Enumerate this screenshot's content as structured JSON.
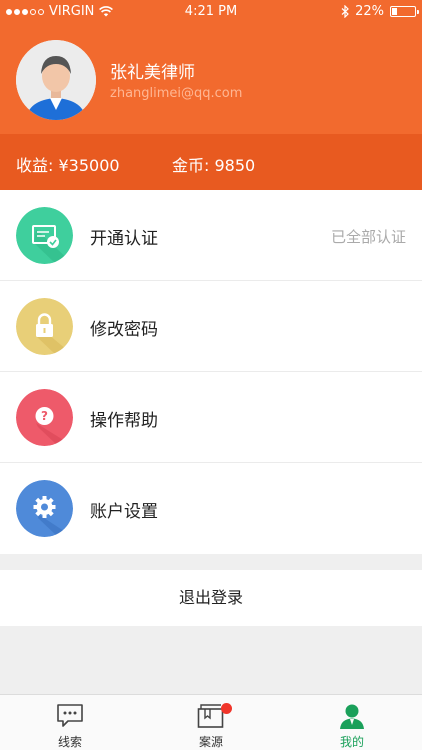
{
  "status_bar": {
    "carrier": "VIRGIN",
    "time": "4:21 PM",
    "battery": "22%",
    "battery_level": 0.22
  },
  "profile": {
    "name": "张礼美律师",
    "email": "zhanglimei@qq.com"
  },
  "stats": {
    "earnings": "收益: ¥35000",
    "coins": "金币: 9850"
  },
  "menu": [
    {
      "label": "开通认证",
      "value": "已全部认证",
      "icon": "certification-icon",
      "color": "#3fcf9d"
    },
    {
      "label": "修改密码",
      "value": "",
      "icon": "lock-icon",
      "color": "#e8cf78"
    },
    {
      "label": "操作帮助",
      "value": "",
      "icon": "help-icon",
      "color": "#ee5a6a"
    },
    {
      "label": "账户设置",
      "value": "",
      "icon": "gear-icon",
      "color": "#4f8ad9"
    }
  ],
  "logout": "退出登录",
  "tabs": [
    {
      "label": "线索",
      "icon": "chat-bubble-icon"
    },
    {
      "label": "案源",
      "icon": "case-book-icon"
    },
    {
      "label": "我的",
      "icon": "person-icon"
    }
  ],
  "colors": {
    "brand": "#f26a2e",
    "active_tab": "#1aa05a"
  }
}
